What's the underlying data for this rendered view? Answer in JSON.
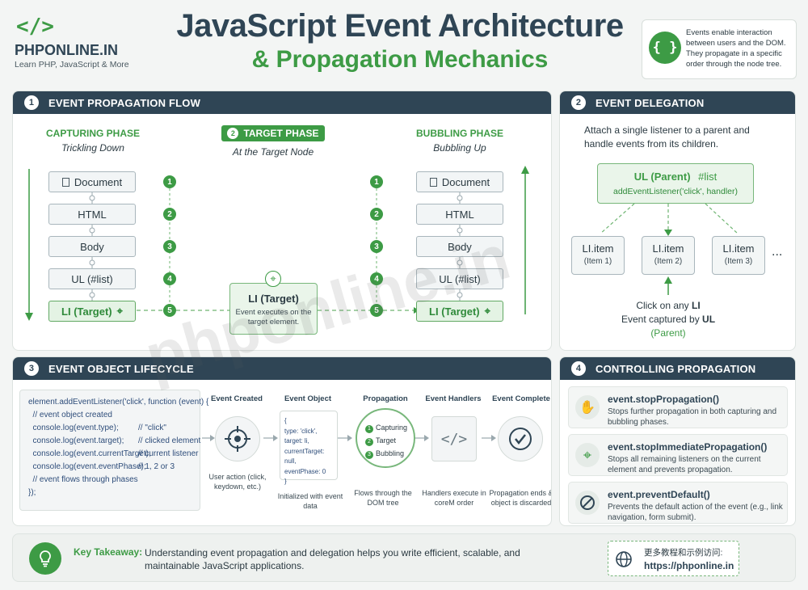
{
  "brand": {
    "name": "PHPONLINE.IN",
    "tagline": "Learn PHP, JavaScript & More"
  },
  "title": {
    "line1": "JavaScript Event Architecture",
    "line2": "& Propagation Mechanics"
  },
  "intro": {
    "icon": "braces-icon",
    "text": "Events enable interaction between users and the DOM. They propagate in a specific order through the node tree."
  },
  "watermark": "phponline.in",
  "section1": {
    "num": "1",
    "title": "EVENT PROPAGATION FLOW",
    "capturing": {
      "title": "CAPTURING PHASE",
      "subtitle": "Trickling Down"
    },
    "target_phase": {
      "num": "2",
      "title": "TARGET PHASE",
      "subtitle": "At the Target Node"
    },
    "bubbling": {
      "title": "BUBBLING PHASE",
      "subtitle": "Bubbling Up"
    },
    "nodes": [
      "Document",
      "HTML",
      "Body",
      "UL (#list)",
      "LI (Target)"
    ],
    "steps": [
      "1",
      "2",
      "3",
      "4",
      "5"
    ],
    "target_box": {
      "title": "LI (Target)",
      "text": "Event executes on the target element."
    }
  },
  "section2": {
    "num": "2",
    "title": "EVENT DELEGATION",
    "text": "Attach a single listener to a parent and handle events from its children.",
    "parent": {
      "label": "UL (Parent)",
      "id": "#list",
      "code": "addEventListener('click', handler)"
    },
    "items": [
      {
        "label": "LI.item",
        "sub": "(Item 1)"
      },
      {
        "label": "LI.item",
        "sub": "(Item 2)"
      },
      {
        "label": "LI.item",
        "sub": "(Item 3)"
      }
    ],
    "ellipsis": "...",
    "click_line1": "Click on any ",
    "click_li": "LI",
    "click_line2": "Event captured by ",
    "click_ul": "UL",
    "click_line3": "(Parent)"
  },
  "section3": {
    "num": "3",
    "title": "EVENT OBJECT LIFECYCLE",
    "code": [
      {
        "code": "element.addEventListener('click', function (event) {",
        "comment": ""
      },
      {
        "code": "  // event object created",
        "comment": ""
      },
      {
        "code": "  console.log(event.type);",
        "comment": "// \"click\""
      },
      {
        "code": "  console.log(event.target);",
        "comment": "// clicked element"
      },
      {
        "code": "  console.log(event.currentTarget);",
        "comment": "// current listener"
      },
      {
        "code": "  console.log(event.eventPhase);",
        "comment": "// 1, 2 or 3"
      },
      {
        "code": "  // event flows through phases",
        "comment": ""
      },
      {
        "code": "});",
        "comment": ""
      }
    ],
    "stages": [
      {
        "title": "Event Created",
        "caption": "User action (click, keydown, etc.)"
      },
      {
        "title": "Event Object",
        "caption": "Initialized with event data"
      },
      {
        "title": "Propagation",
        "caption": "Flows through the DOM tree"
      },
      {
        "title": "Event Handlers",
        "caption": "Handlers execute in coreM order"
      },
      {
        "title": "Event Complete",
        "caption": "Propagation ends & object is discarded"
      }
    ],
    "event_object_lines": [
      "{",
      "type: 'click',",
      "target: li,",
      "currentTarget: null,",
      "eventPhase: 0",
      "}"
    ],
    "propagation_steps": [
      {
        "num": "1",
        "label": "Capturing"
      },
      {
        "num": "2",
        "label": "Target"
      },
      {
        "num": "3",
        "label": "Bubbling"
      }
    ]
  },
  "section4": {
    "num": "4",
    "title": "CONTROLLING PROPAGATION",
    "items": [
      {
        "icon": "hand-stop-icon",
        "title": "event.stopPropagation()",
        "desc": "Stops further propagation in both capturing and bubbling phases."
      },
      {
        "icon": "crosshair-icon",
        "title": "event.stopImmediatePropagation()",
        "desc": "Stops all remaining listeners on the current element and prevents propagation."
      },
      {
        "icon": "prohibited-icon",
        "title": "event.preventDefault()",
        "desc": "Prevents the default action of the event (e.g., link navigation, form submit)."
      }
    ]
  },
  "footer": {
    "label": "Key Takeaway:",
    "text": "Understanding event propagation and delegation helps you write efficient, scalable, and maintainable JavaScript applications.",
    "visit_label": "更多教程和示例访问:",
    "url": "https://phponline.in"
  },
  "colors": {
    "header": "#2f4555",
    "accent": "#3d9b45",
    "code": "#2e4d7a"
  }
}
